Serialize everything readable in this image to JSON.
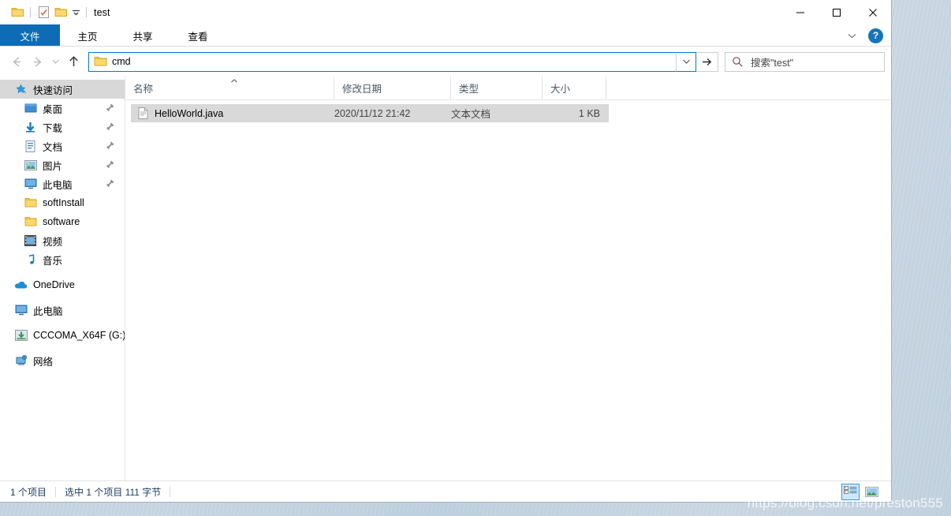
{
  "window": {
    "title": "test",
    "quick_access_toolbar": [
      {
        "name": "folder-icon",
        "label": "属性"
      },
      {
        "name": "properties-icon",
        "label": "属性"
      },
      {
        "name": "new-folder-icon",
        "label": "新建文件夹"
      },
      {
        "name": "chevron-down-icon",
        "label": "自定义快速访问工具栏"
      }
    ],
    "controls": {
      "minimize": "—",
      "maximize": "□",
      "close": "✕"
    }
  },
  "ribbon": {
    "tabs": [
      {
        "label": "文件",
        "active": true
      },
      {
        "label": "主页",
        "active": false
      },
      {
        "label": "共享",
        "active": false
      },
      {
        "label": "查看",
        "active": false
      }
    ],
    "expand_icon": "chevron-down-icon",
    "help_label": "?"
  },
  "navigation": {
    "back": "←",
    "forward": "→",
    "recent": "⌄",
    "up": "↑"
  },
  "address": {
    "folder_icon": "folder-icon",
    "path_text": "cmd",
    "dropdown_icon": "chevron-down-icon",
    "go_icon": "arrow-right-icon"
  },
  "search": {
    "icon": "search-icon",
    "placeholder": "搜索\"test\""
  },
  "sidebar": {
    "items": [
      {
        "label": "快速访问",
        "icon": "star-pin-icon",
        "selected": true,
        "pinned": false,
        "indent": 0
      },
      {
        "label": "桌面",
        "icon": "desktop-icon",
        "selected": false,
        "pinned": true,
        "indent": 1
      },
      {
        "label": "下载",
        "icon": "download-icon",
        "selected": false,
        "pinned": true,
        "indent": 1
      },
      {
        "label": "文档",
        "icon": "documents-icon",
        "selected": false,
        "pinned": true,
        "indent": 1
      },
      {
        "label": "图片",
        "icon": "pictures-icon",
        "selected": false,
        "pinned": true,
        "indent": 1
      },
      {
        "label": "此电脑",
        "icon": "this-pc-icon",
        "selected": false,
        "pinned": true,
        "indent": 1
      },
      {
        "label": "softInstall",
        "icon": "folder-icon",
        "selected": false,
        "pinned": false,
        "indent": 1
      },
      {
        "label": "software",
        "icon": "folder-icon",
        "selected": false,
        "pinned": false,
        "indent": 1
      },
      {
        "label": "视频",
        "icon": "videos-icon",
        "selected": false,
        "pinned": false,
        "indent": 1
      },
      {
        "label": "音乐",
        "icon": "music-icon",
        "selected": false,
        "pinned": false,
        "indent": 1
      },
      {
        "label": "OneDrive",
        "icon": "onedrive-icon",
        "selected": false,
        "pinned": false,
        "indent": 0
      },
      {
        "label": "此电脑",
        "icon": "this-pc-icon",
        "selected": false,
        "pinned": false,
        "indent": 0
      },
      {
        "label": "CCCOMA_X64F (G:)",
        "icon": "dvd-drive-icon",
        "selected": false,
        "pinned": false,
        "indent": 0
      },
      {
        "label": "网络",
        "icon": "network-icon",
        "selected": false,
        "pinned": false,
        "indent": 0
      }
    ]
  },
  "filelist": {
    "columns": [
      {
        "label": "名称",
        "sorted": "asc"
      },
      {
        "label": "修改日期",
        "sorted": ""
      },
      {
        "label": "类型",
        "sorted": ""
      },
      {
        "label": "大小",
        "sorted": ""
      }
    ],
    "rows": [
      {
        "name": "HelloWorld.java",
        "icon": "text-file-icon",
        "date": "2020/11/12 21:42",
        "type": "文本文档",
        "size": "1 KB",
        "selected": true
      }
    ]
  },
  "statusbar": {
    "item_count": "1 个项目",
    "selection": "选中 1 个项目  111 字节",
    "views": [
      {
        "name": "details-view-button",
        "active": true
      },
      {
        "name": "large-icons-view-button",
        "active": false
      }
    ]
  },
  "watermark": {
    "text": "https://blog.csdn.net/preston555"
  },
  "colors": {
    "accent": "#0d6cb5",
    "selection": "#d9d9d9",
    "sidebar_selection": "#d8d8d8",
    "address_focus_border": "#0078d7",
    "status_text": "#1a3a5c"
  }
}
